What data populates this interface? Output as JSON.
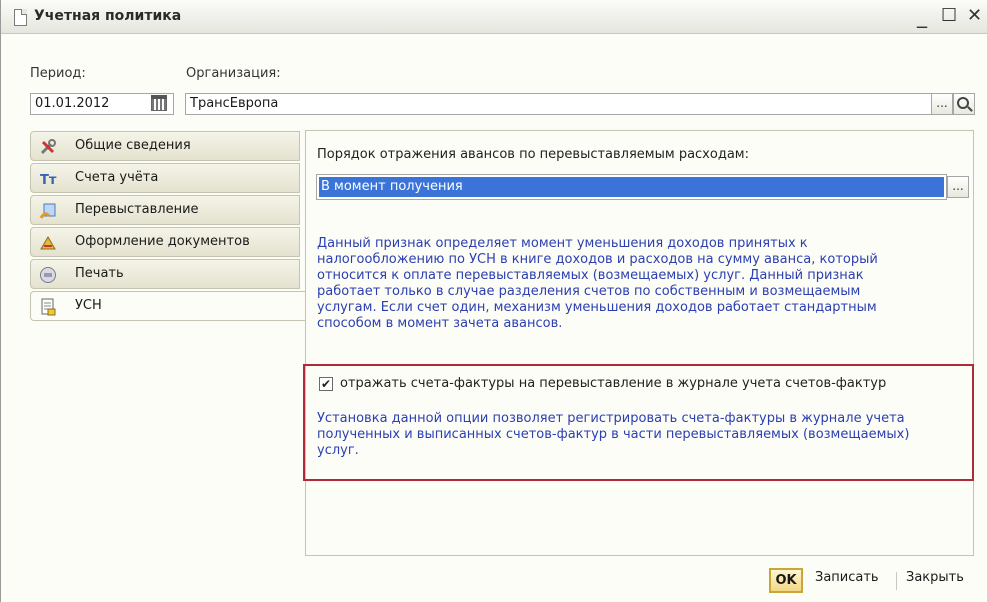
{
  "window": {
    "title": "Учетная политика",
    "minimize": "_",
    "maximize": "☐",
    "close": "✕"
  },
  "header": {
    "period_label": "Период:",
    "period_value": "01.01.2012",
    "org_label": "Организация:",
    "org_value": "ТрансЕвропа",
    "org_select_btn": "...",
    "colors": {
      "accent": "#3a74d8",
      "help_text": "#2b3fb0",
      "highlight_border": "#b22a3a"
    }
  },
  "tabs": [
    {
      "label": "Общие сведения",
      "icon": "wrench-icon"
    },
    {
      "label": "Счета учёта",
      "icon": "accounts-icon"
    },
    {
      "label": "Перевыставление",
      "icon": "reissue-icon"
    },
    {
      "label": "Оформление документов",
      "icon": "documents-icon"
    },
    {
      "label": "Печать",
      "icon": "print-icon"
    },
    {
      "label": "УСН",
      "icon": "usn-icon",
      "active": true
    }
  ],
  "main": {
    "advances_label": "Порядок отражения авансов по  перевыставляемым расходам:",
    "advances_value": "В момент получения",
    "advances_select_btn": "...",
    "help_text_lines": [
      "Данный признак определяет момент уменьшения доходов принятых к",
      "налогообложению по УСН в книге доходов и расходов на сумму аванса, который",
      "относится к оплате перевыставляемых (возмещаемых) услуг. Данный признак",
      "работает только в случае разделения счетов по собственным и возмещаемым",
      "услугам. Если счет один, механизм уменьшения доходов работает стандартным",
      "способом в момент зачета авансов."
    ],
    "checkbox_label": "отражать счета-фактуры на перевыставление в журнале учета счетов-фактур",
    "checkbox_checked": true,
    "checkbox_help_lines": [
      "Установка данной опции позволяет регистрировать счета-фактуры в журнале учета",
      "полученных и выписанных счетов-фактур в части перевыставляемых (возмещаемых)",
      "услуг."
    ]
  },
  "footer": {
    "ok_label": "OK",
    "save_label": "Записать",
    "close_label": "Закрыть"
  }
}
